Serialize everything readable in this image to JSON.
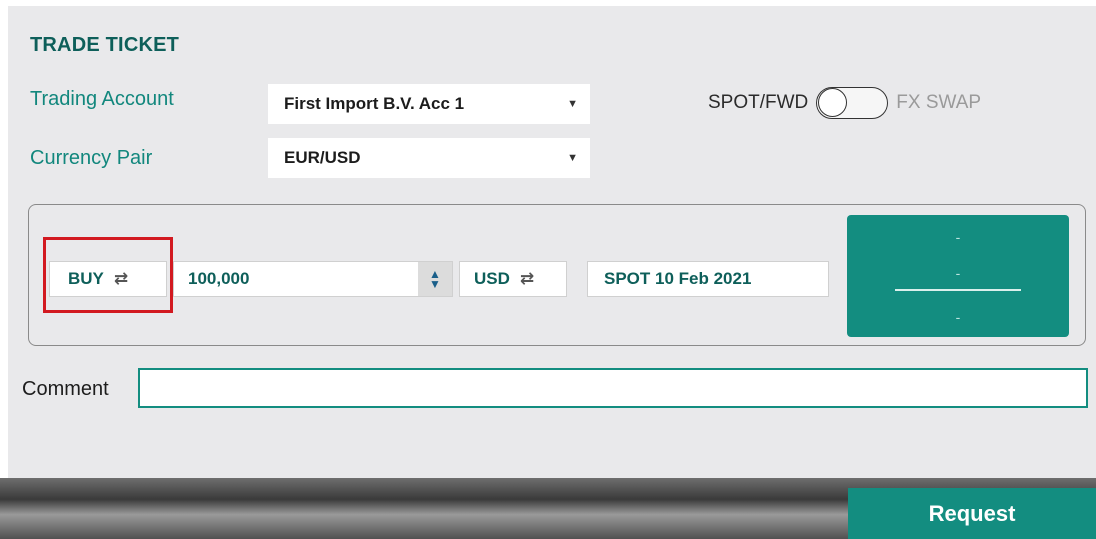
{
  "ticket": {
    "title": "TRADE TICKET",
    "trading_account_label": "Trading Account",
    "trading_account_value": "First Import B.V. Acc 1",
    "currency_pair_label": "Currency Pair",
    "currency_pair_value": "EUR/USD",
    "caret_icon": "▼"
  },
  "toggle": {
    "left_label": "SPOT/FWD",
    "right_label": "FX SWAP",
    "state": "SPOT/FWD"
  },
  "trade": {
    "direction": "BUY",
    "swap_icon": "⇄",
    "amount": "100,000",
    "stepper_up": "▲",
    "stepper_down": "▼",
    "currency": "USD",
    "value_date": "SPOT 10 Feb 2021",
    "price_top": "-",
    "price_mid": "-",
    "price_bottom": "-"
  },
  "comment": {
    "label": "Comment",
    "value": ""
  },
  "request_button": "Request",
  "colors": {
    "accent": "#138d80",
    "highlight": "#d21920",
    "label": "#12877d",
    "title": "#0e5f5a"
  }
}
